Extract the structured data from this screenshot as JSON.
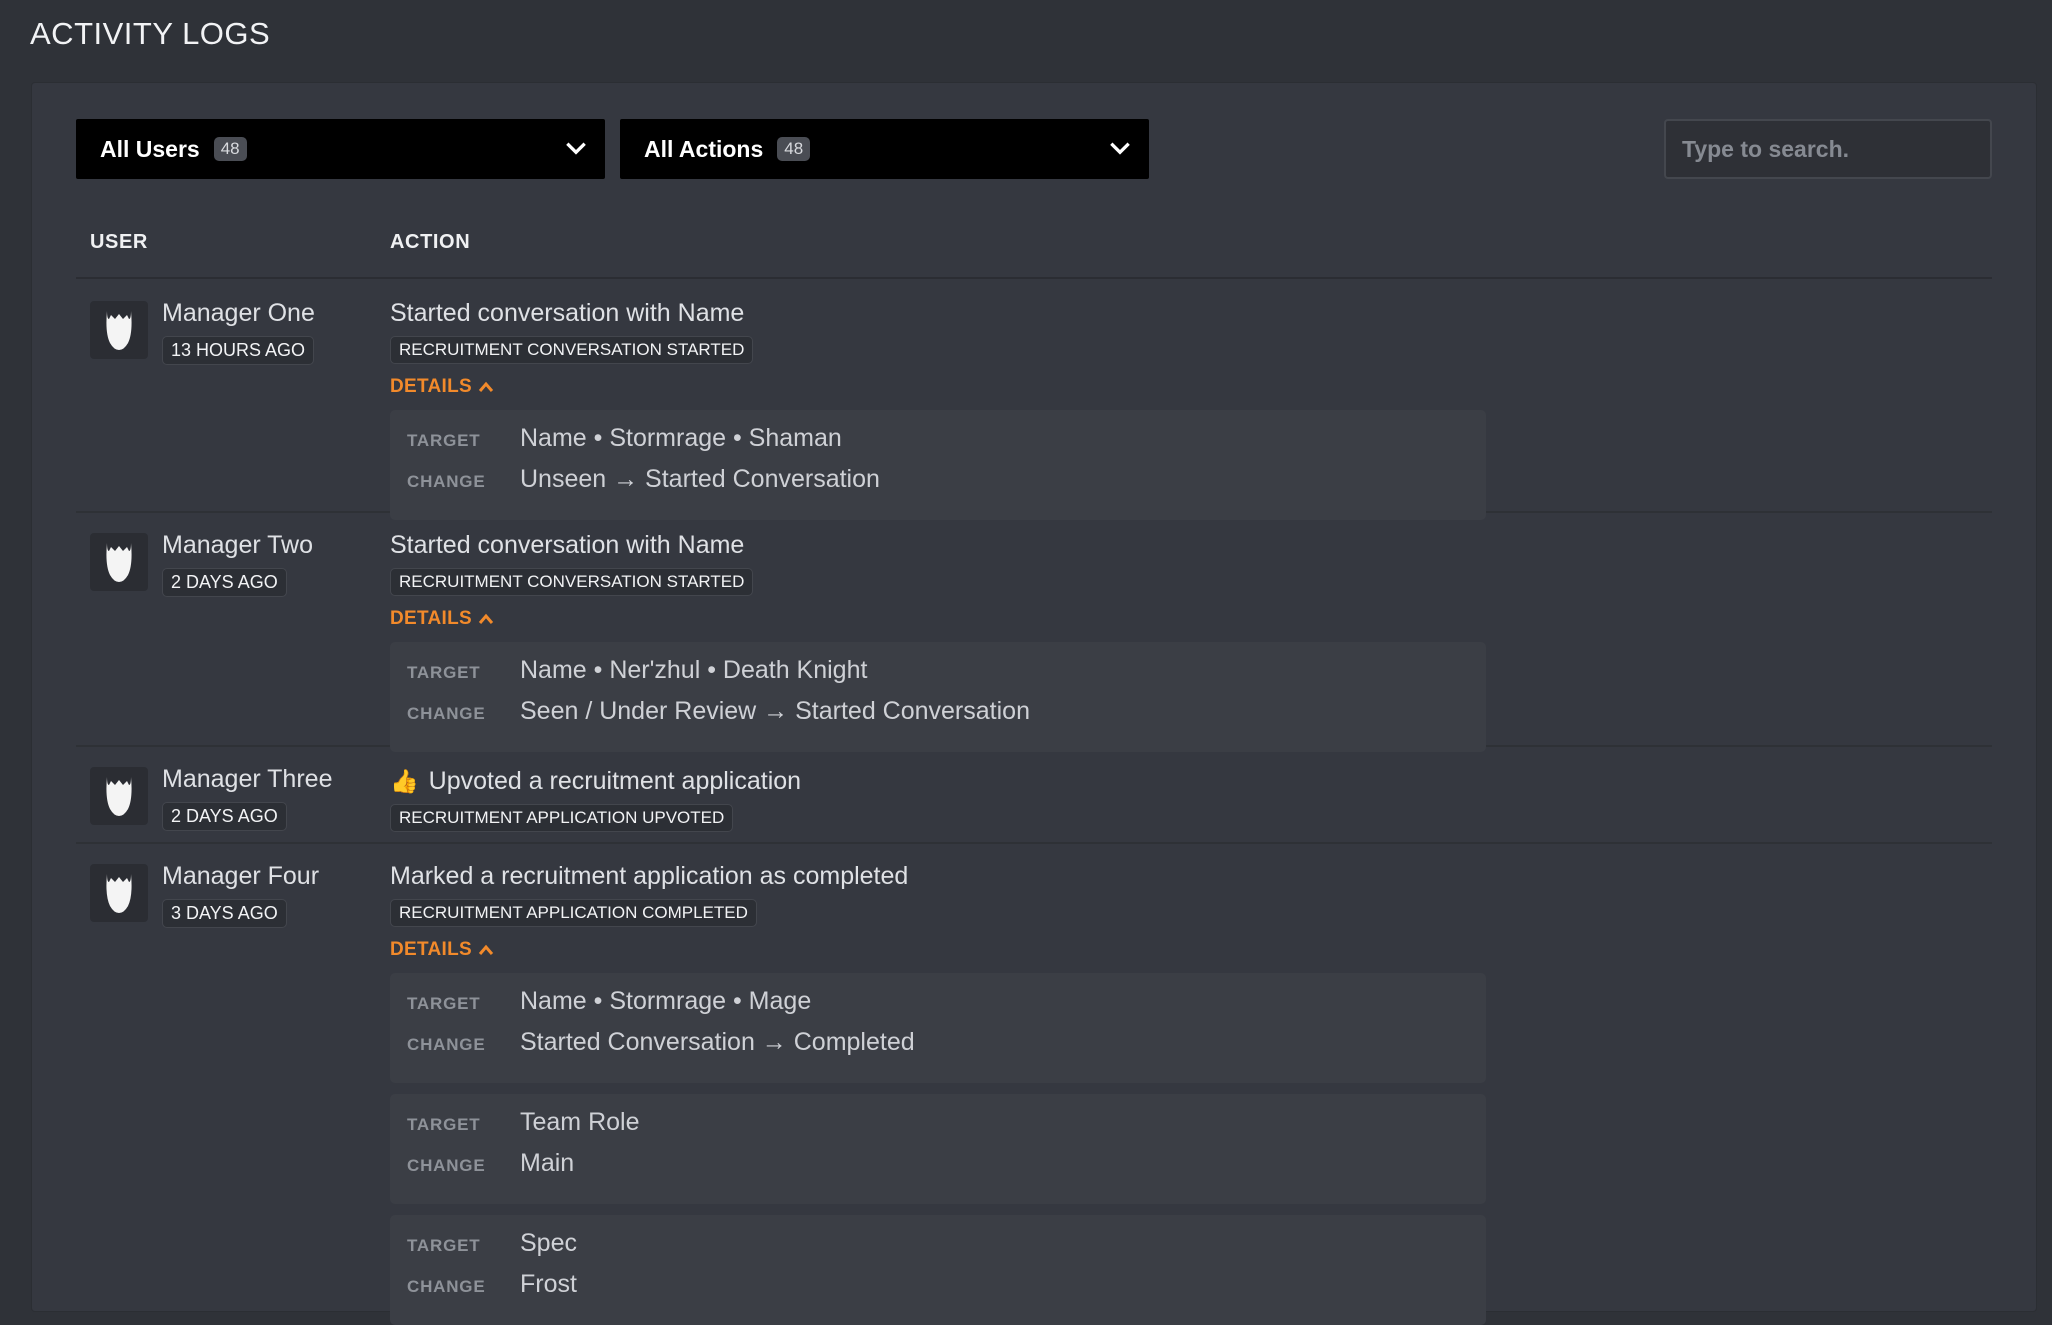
{
  "page": {
    "title": "ACTIVITY LOGS"
  },
  "filters": {
    "users": {
      "label": "All Users",
      "count": "48"
    },
    "actions": {
      "label": "All Actions",
      "count": "48"
    },
    "search": {
      "placeholder": "Type to search."
    }
  },
  "table": {
    "headers": {
      "user": "USER",
      "action": "ACTION"
    },
    "rows": [
      {
        "user": "Manager One",
        "time": "13 HOURS AGO",
        "action": "Started conversation with Name",
        "tag": "RECRUITMENT CONVERSATION STARTED",
        "details_label": "DETAILS",
        "details": [
          {
            "target_key": "TARGET",
            "target": "Name • Stormrage • Shaman",
            "change_key": "CHANGE",
            "change": "Unseen → Started Conversation"
          }
        ]
      },
      {
        "user": "Manager Two",
        "time": "2 DAYS AGO",
        "action": "Started conversation with Name",
        "tag": "RECRUITMENT CONVERSATION STARTED",
        "details_label": "DETAILS",
        "details": [
          {
            "target_key": "TARGET",
            "target": "Name • Ner'zhul • Death Knight",
            "change_key": "CHANGE",
            "change": "Seen / Under Review → Started Conversation"
          }
        ]
      },
      {
        "user": "Manager Three",
        "time": "2 DAYS AGO",
        "action_emoji": "👍",
        "action": "Upvoted a recruitment application",
        "tag": "RECRUITMENT APPLICATION UPVOTED"
      },
      {
        "user": "Manager Four",
        "time": "3 DAYS AGO",
        "action": "Marked a recruitment application as completed",
        "tag": "RECRUITMENT APPLICATION COMPLETED",
        "details_label": "DETAILS",
        "details": [
          {
            "target_key": "TARGET",
            "target": "Name • Stormrage • Mage",
            "change_key": "CHANGE",
            "change": "Started Conversation → Completed"
          },
          {
            "target_key": "TARGET",
            "target": "Team Role",
            "change_key": "CHANGE",
            "change": "Main"
          },
          {
            "target_key": "TARGET",
            "target": "Spec",
            "change_key": "CHANGE",
            "change": "Frost"
          }
        ]
      }
    ]
  },
  "colors": {
    "accent": "#f28a2b",
    "background": "#2f3238",
    "panel": "#353840"
  }
}
